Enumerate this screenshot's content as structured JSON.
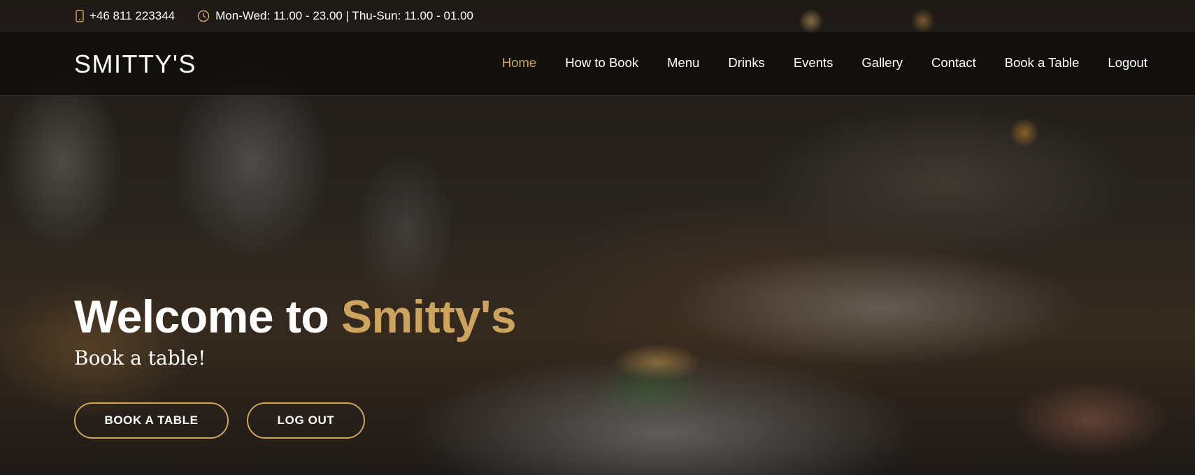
{
  "topbar": {
    "phone": "+46 811 223344",
    "hours": "Mon-Wed: 11.00 - 23.00 | Thu-Sun: 11.00 - 01.00",
    "phone_icon": "phone-icon",
    "clock_icon": "clock-icon"
  },
  "navbar": {
    "logo": "SMITTY'S",
    "items": [
      {
        "label": "Home",
        "active": true
      },
      {
        "label": "How to Book"
      },
      {
        "label": "Menu"
      },
      {
        "label": "Drinks"
      },
      {
        "label": "Events"
      },
      {
        "label": "Gallery"
      },
      {
        "label": "Contact"
      },
      {
        "label": "Book a Table"
      },
      {
        "label": "Logout"
      }
    ]
  },
  "hero": {
    "title_prefix": "Welcome to",
    "title_accent": "Smitty's",
    "subtitle": "Book a table!",
    "book_button": "BOOK A TABLE",
    "logout_button": "LOG OUT"
  },
  "colors": {
    "accent": "#cda45e",
    "nav_bg": "#0c0b09"
  }
}
